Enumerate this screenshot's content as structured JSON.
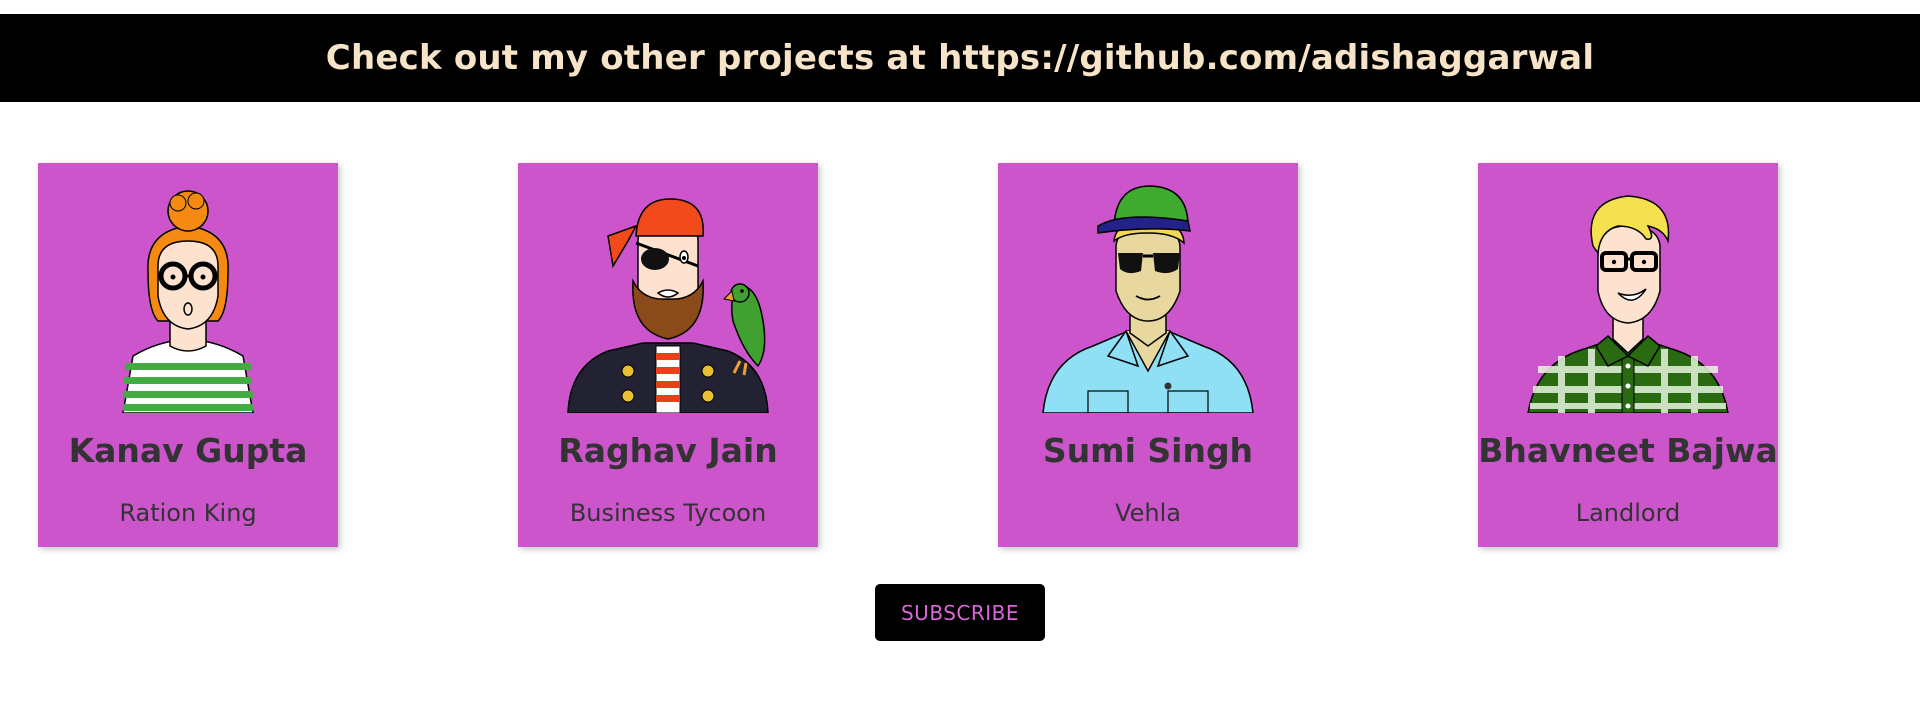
{
  "banner": {
    "text": "Check out my other projects at https://github.com/adishaggarwal"
  },
  "colors": {
    "banner_bg": "#000000",
    "banner_text": "#f7e4c8",
    "card_bg": "#cc55cc",
    "subscribe_bg": "#000000",
    "subscribe_text": "#dd66dd"
  },
  "cards": [
    {
      "name": "Kanav Gupta",
      "role": "Ration King",
      "avatar_icon": "orange-bun-hair-glasses-striped-shirt-avatar"
    },
    {
      "name": "Raghav Jain",
      "role": "Business Tycoon",
      "avatar_icon": "pirate-eyepatch-parrot-avatar"
    },
    {
      "name": "Sumi Singh",
      "role": "Vehla",
      "avatar_icon": "green-cap-sunglasses-avatar"
    },
    {
      "name": "Bhavneet Bajwa",
      "role": "Landlord",
      "avatar_icon": "blonde-glasses-checkered-shirt-avatar"
    }
  ],
  "subscribe": {
    "label": "SUBSCRIBE"
  }
}
